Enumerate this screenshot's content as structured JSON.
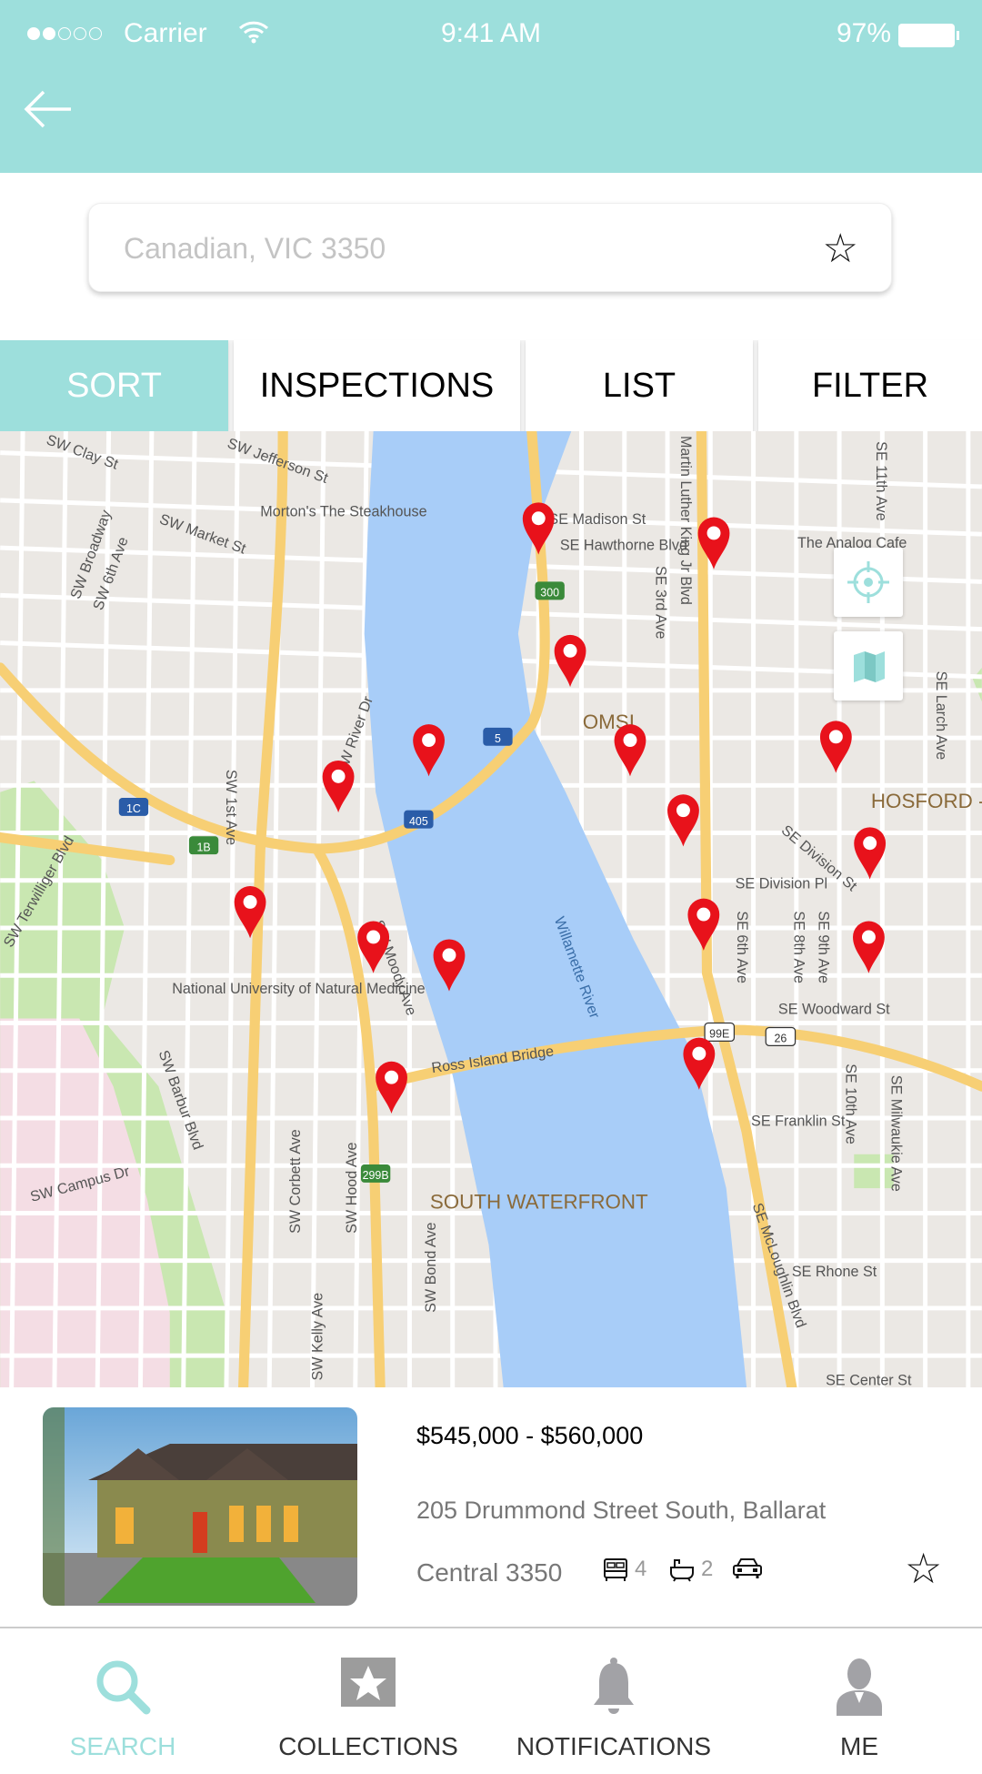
{
  "status_bar": {
    "carrier": "Carrier",
    "time": "9:41 AM",
    "battery": "97%",
    "signal_bars": 2
  },
  "header": {
    "back_icon": "arrow-left-icon"
  },
  "search": {
    "placeholder": "Canadian, VIC 3350",
    "value": ""
  },
  "tabs": [
    {
      "label": "SORT",
      "active": true
    },
    {
      "label": "INSPECTIONS"
    },
    {
      "label": "LIST"
    },
    {
      "label": "FILTER"
    }
  ],
  "map": {
    "labels": [
      "SW Clay St",
      "SW Jefferson St",
      "Morton's The Steakhouse",
      "SW Market St",
      "SE Madison St",
      "SE Hawthorne Blvd",
      "Martin Luther King Jr Blvd",
      "SE 3rd Ave",
      "The Analog Cafe",
      "OMSI",
      "HOSFORD - ABERNETHY",
      "SE Division Pl",
      "SE Division St",
      "National University of Natural Medicine",
      "SW Moody Ave",
      "Willamette River",
      "Ross Island Bridge",
      "SE Woodward St",
      "SE Franklin St",
      "SOUTH WATERFRONT",
      "SE McLoughlin Blvd",
      "SE Rhone St",
      "SE Center St",
      "SW Terwilliger Blvd",
      "SW Campus Dr",
      "SW River Dr",
      "SW 1st Ave",
      "SW Broadway",
      "SW 6th Ave",
      "SW Corbett Ave",
      "SW Hood Ave",
      "SW Bond Ave",
      "SW Kelly Ave",
      "SW Barbur Blvd",
      "SE 6th Ave",
      "SE 8th Ave",
      "SE 9th Ave",
      "SE 10th Ave",
      "SE Milwaukie Ave",
      "SE 11th Ave",
      "SE Larch Ave"
    ],
    "shields": [
      "405",
      "5",
      "300",
      "99E",
      "26",
      "299B",
      "1C",
      "1B"
    ],
    "locate_icon": "crosshair-icon",
    "layers_icon": "map-layers-icon",
    "pin_color": "#e8121b"
  },
  "listing": {
    "price": "$545,000 - $560,000",
    "address": "205 Drummond Street South, Ballarat",
    "suburb": "Central 3350",
    "beds": "4",
    "baths": "2",
    "bed_icon": "bed-icon",
    "bath_icon": "bath-icon",
    "car_icon": "car-icon"
  },
  "nav": [
    {
      "label": "SEARCH",
      "icon": "search-icon",
      "active": true
    },
    {
      "label": "COLLECTIONS",
      "icon": "star-box-icon"
    },
    {
      "label": "NOTIFICATIONS",
      "icon": "bell-icon"
    },
    {
      "label": "ME",
      "icon": "user-icon"
    }
  ],
  "colors": {
    "accent": "#9ddfdc",
    "water": "#a8cdf8",
    "highway": "#f7cf74",
    "park": "#c9e7b1"
  }
}
